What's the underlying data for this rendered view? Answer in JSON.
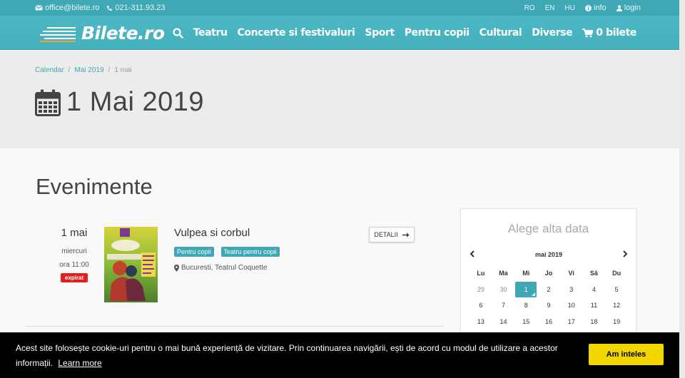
{
  "topbar": {
    "email": "office@bilete.ro",
    "phone": "021-311.93.23",
    "languages": [
      "RO",
      "EN",
      "HU"
    ],
    "info_label": "info",
    "login_label": "login"
  },
  "header": {
    "brand": "Bilete.ro",
    "nav": [
      "Teatru",
      "Concerte si festivaluri",
      "Sport",
      "Pentru copii",
      "Cultural",
      "Diverse"
    ],
    "cart_label": "0 bilete",
    "icons": {
      "search": "search-icon",
      "cart": "shopping-cart-icon"
    }
  },
  "breadcrumb": {
    "items": [
      "Calendar",
      "Mai 2019"
    ],
    "current": "1 mai"
  },
  "page": {
    "title": "1 Mai 2019",
    "icon": "calendar-icon"
  },
  "events_section": {
    "title": "Evenimente",
    "events": [
      {
        "day": "1 mai",
        "weekday": "miercuri",
        "time": "ora 11:00",
        "status": "expirat",
        "name": "Vulpea si corbul",
        "tags": [
          "Pentru copii",
          "Teatru pentru copii"
        ],
        "location": "Bucuresti, Teatrul Coquette",
        "details_label": "DETALII"
      }
    ]
  },
  "calendar": {
    "title": "Alege alta data",
    "month": "mai 2019",
    "day_headers": [
      "Lu",
      "Ma",
      "Mi",
      "Jo",
      "Vi",
      "Sâ",
      "Du"
    ],
    "weeks": [
      [
        "29",
        "30",
        "1",
        "2",
        "3",
        "4",
        "5"
      ],
      [
        "6",
        "7",
        "8",
        "9",
        "10",
        "11",
        "12"
      ],
      [
        "13",
        "14",
        "15",
        "16",
        "17",
        "18",
        "19"
      ]
    ],
    "selected": "1",
    "accent": "#3fa8b4"
  },
  "cookie": {
    "message": "Acest site folosește cookie-uri pentru o mai bună experiență de vizitare. Prin continuarea navigării, ești de acord cu modul de utilizare a acestor informații.",
    "link_label": "Learn more",
    "button_label": "Am inteles",
    "button_color": "#f1d600"
  }
}
